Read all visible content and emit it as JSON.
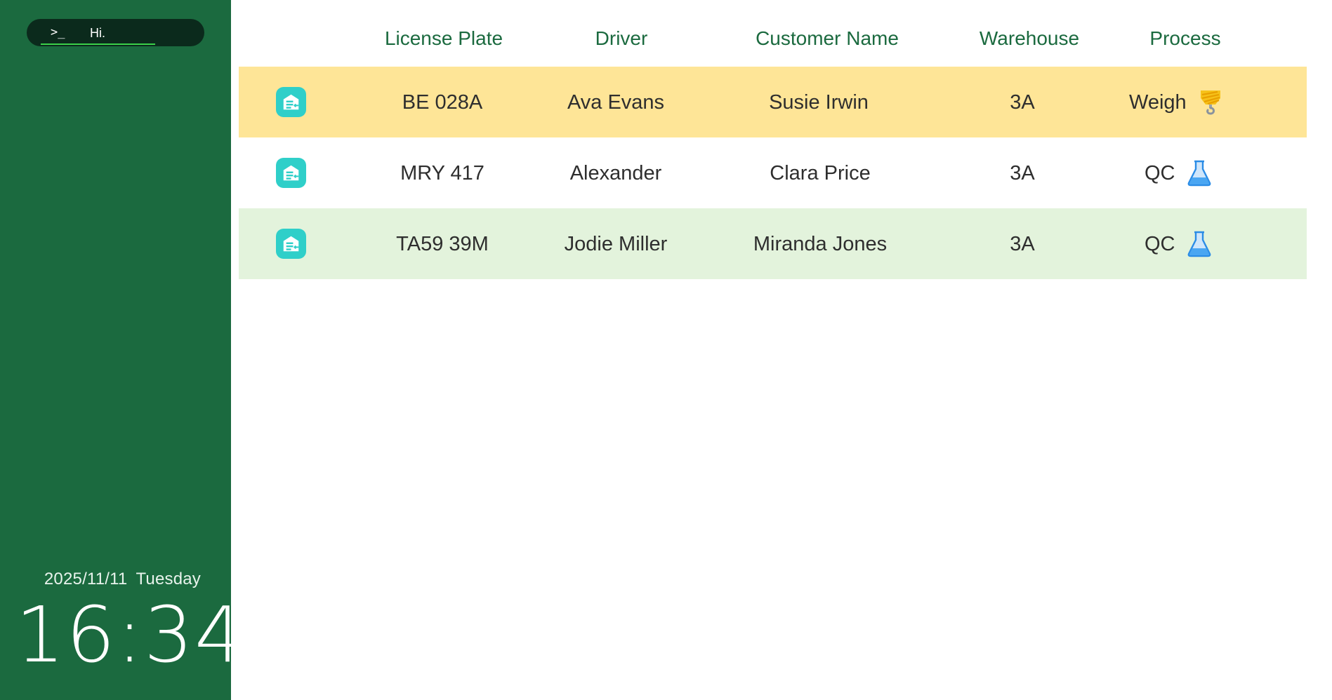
{
  "sidebar": {
    "terminal": {
      "prompt": ">_",
      "text": "Hi."
    },
    "date": "2025/11/11",
    "weekday": "Tuesday",
    "time": "16:34"
  },
  "table": {
    "headers": {
      "license_plate": "License Plate",
      "driver": "Driver",
      "customer_name": "Customer Name",
      "warehouse": "Warehouse",
      "process": "Process"
    },
    "rows": [
      {
        "license_plate": "BE 028A",
        "driver": "Ava Evans",
        "customer_name": "Susie Irwin",
        "warehouse": "3A",
        "process": "Weigh",
        "process_icon": "crane-hook-icon",
        "row_color": "#fee597"
      },
      {
        "license_plate": "MRY 417",
        "driver": "Alexander",
        "customer_name": "Clara Price",
        "warehouse": "3A",
        "process": "QC",
        "process_icon": "flask-icon",
        "row_color": "#ffffff"
      },
      {
        "license_plate": "TA59 39M",
        "driver": "Jodie Miller",
        "customer_name": "Miranda Jones",
        "warehouse": "3A",
        "process": "QC",
        "process_icon": "flask-icon",
        "row_color": "#e3f3dc"
      }
    ]
  },
  "colors": {
    "sidebar_bg": "#1b6a3f",
    "header_text": "#1b6a3f",
    "accent_icon": "#2fcfc9"
  }
}
